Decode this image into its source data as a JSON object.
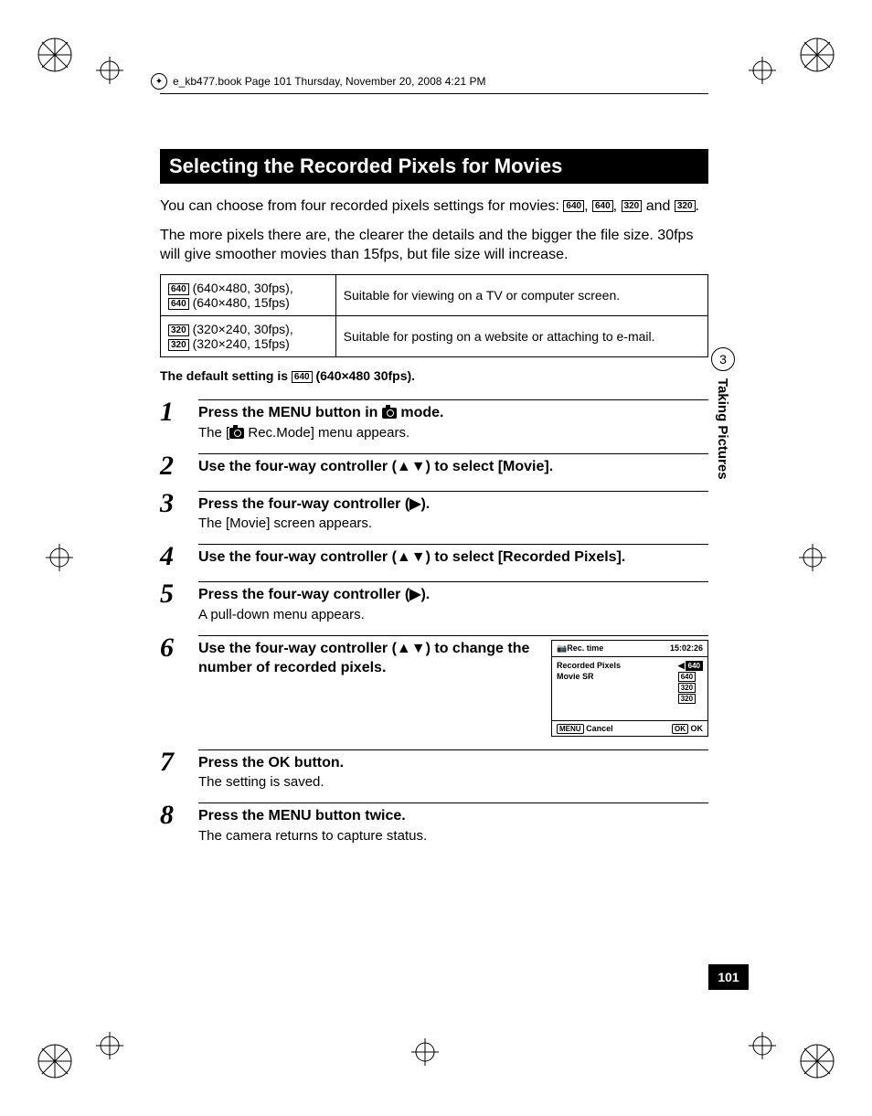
{
  "source_line": "e_kb477.book  Page 101  Thursday, November 20, 2008  4:21 PM",
  "section_heading": "Selecting the Recorded Pixels for Movies",
  "intro_line1": "You can choose from four recorded pixels settings for movies: ",
  "intro_icons": [
    "640",
    "640",
    "320",
    "320"
  ],
  "intro_and": " and ",
  "intro_period": ".",
  "intro_line2": "The more pixels there are, the clearer the details and the bigger the file size. 30fps will give smoother movies than 15fps, but file size will increase.",
  "table": {
    "rows": [
      {
        "icons": [
          "640",
          "640"
        ],
        "specs": [
          "(640×480, 30fps),",
          "(640×480, 15fps)"
        ],
        "desc": "Suitable for viewing on a TV or computer screen."
      },
      {
        "icons": [
          "320",
          "320"
        ],
        "specs": [
          "(320×240, 30fps),",
          "(320×240, 15fps)"
        ],
        "desc": "Suitable for posting on a website or attaching to e-mail."
      }
    ]
  },
  "default_pre": "The default setting is ",
  "default_icon": "640",
  "default_post": " (640×480 30fps).",
  "steps": [
    {
      "n": "1",
      "title_pre": "Press the ",
      "title_menu": "MENU",
      "title_mid": " button in ",
      "title_post": " mode.",
      "desc_pre": "The [",
      "desc_post": " Rec.Mode] menu appears."
    },
    {
      "n": "2",
      "title": "Use the four-way controller (▲▼) to select [Movie]."
    },
    {
      "n": "3",
      "title": "Press the four-way controller (▶).",
      "desc": "The [Movie] screen appears."
    },
    {
      "n": "4",
      "title": "Use the four-way controller (▲▼) to select [Recorded Pixels]."
    },
    {
      "n": "5",
      "title": "Press the four-way controller (▶).",
      "desc": "A pull-down menu appears."
    },
    {
      "n": "6",
      "title": "Use the four-way controller (▲▼) to change the number of recorded pixels."
    },
    {
      "n": "7",
      "title_pre": "Press the ",
      "title_ok": "OK",
      "title_post": " button.",
      "desc": "The setting is saved."
    },
    {
      "n": "8",
      "title_pre": "Press the ",
      "title_menu": "MENU",
      "title_post": " button twice.",
      "desc": "The camera returns to capture status."
    }
  ],
  "screen": {
    "rec_time_label": "Rec. time",
    "rec_time_value": "15:02:26",
    "row1": "Recorded Pixels",
    "row2": "Movie SR",
    "options": [
      "640",
      "640",
      "320",
      "320"
    ],
    "cancel_btn": "MENU",
    "cancel_label": "Cancel",
    "ok_btn": "OK",
    "ok_label": "OK"
  },
  "side": {
    "chapter": "3",
    "label": "Taking Pictures"
  },
  "page_number": "101"
}
